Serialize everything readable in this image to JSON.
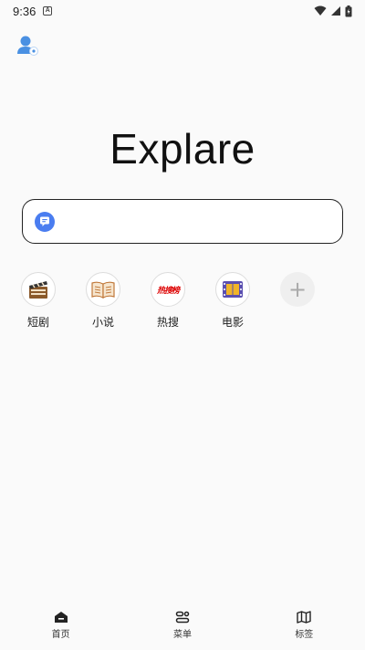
{
  "status_bar": {
    "time": "9:36",
    "notification_letter": "A"
  },
  "brand": {
    "title": "Explare"
  },
  "search": {
    "value": "",
    "placeholder": ""
  },
  "shortcuts": [
    {
      "label": "短剧",
      "icon": "clapperboard-icon"
    },
    {
      "label": "小说",
      "icon": "open-book-icon"
    },
    {
      "label": "热搜",
      "icon": "hot-search-icon",
      "badge_text": "热搜榜"
    },
    {
      "label": "电影",
      "icon": "film-strip-icon"
    }
  ],
  "add_shortcut": {
    "icon": "plus-icon",
    "symbol": "+"
  },
  "bottom_nav": [
    {
      "label": "首页",
      "icon": "home-icon"
    },
    {
      "label": "菜单",
      "icon": "menu-icon"
    },
    {
      "label": "标签",
      "icon": "tabs-map-icon"
    }
  ],
  "colors": {
    "background": "#fafafa",
    "search_border": "#222222",
    "engine_blue": "#4a7df0",
    "hot_red": "#dd0000"
  }
}
